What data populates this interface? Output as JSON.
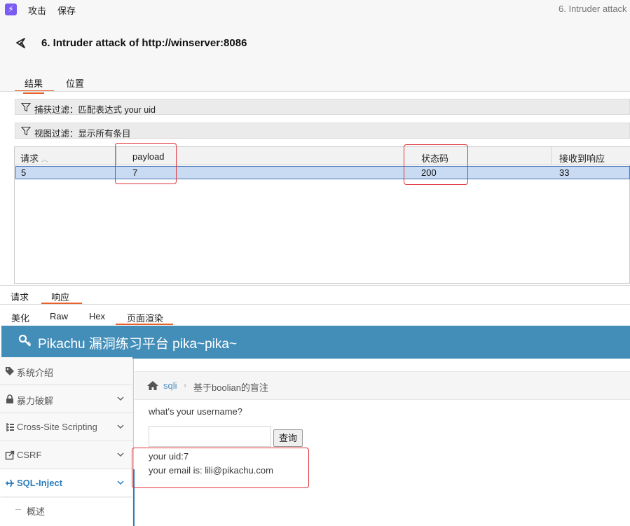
{
  "menubar": {
    "items": [
      "攻击",
      "保存"
    ],
    "window_title": "6. Intruder attack"
  },
  "attack": {
    "title": "6. Intruder attack of http://winserver:8086"
  },
  "top_tabs": [
    "结果",
    "位置"
  ],
  "filters": {
    "capture": "捕获过滤：匹配表达式 your uid",
    "view": "视图过滤：显示所有条目"
  },
  "table": {
    "columns": [
      "请求",
      "payload",
      "状态码",
      "接收到响应"
    ],
    "rows": [
      [
        "5",
        "7",
        "200",
        "33"
      ]
    ]
  },
  "detail_tabs": [
    "请求",
    "响应"
  ],
  "view_tabs": [
    "美化",
    "Raw",
    "Hex",
    "页面渲染"
  ],
  "page": {
    "banner_title": "Pikachu 漏洞练习平台 pika~pika~",
    "sidebar": [
      "系统介绍",
      "暴力破解",
      "Cross-Site Scripting",
      "CSRF",
      "SQL-Inject"
    ],
    "sidebar_sub": "概述",
    "breadcrumb": {
      "link": "sqli",
      "current": "基于boolian的盲注"
    },
    "question": "what's your username?",
    "button_label": "查询",
    "result_uid": "your uid:7",
    "result_email": "your email is: lili@pikachu.com"
  },
  "colors": {
    "accent": "#e8612c",
    "banner": "#438eb9",
    "highlight": "#e0343a",
    "link": "#2b7dbc"
  }
}
